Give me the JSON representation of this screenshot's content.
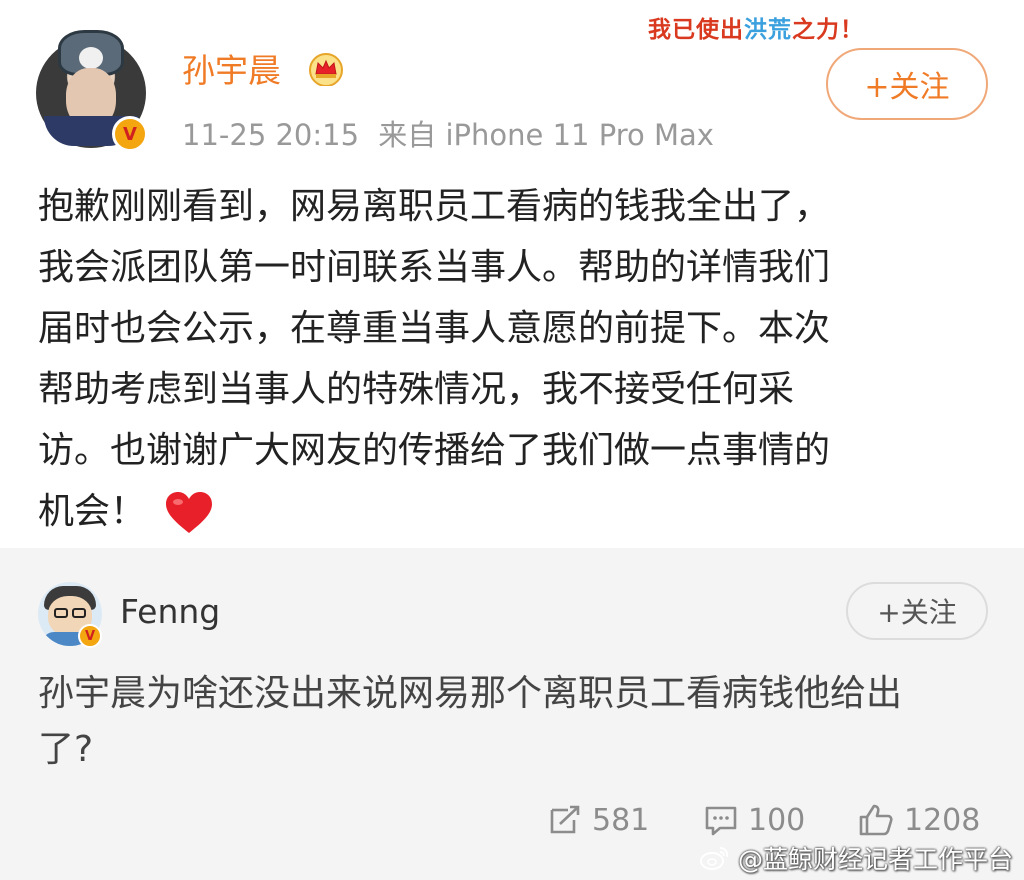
{
  "post": {
    "author": "孙宇晨",
    "time": "11-25 20:15",
    "source": "来自 iPhone 11 Pro Max",
    "follow_label": "+关注",
    "badge_text": "我已使出洪荒之力！",
    "badge_part1": "我已使出",
    "badge_part2": "洪荒",
    "badge_part3": "之力！",
    "verified_letter": "V",
    "lines": [
      "抱歉刚刚看到，网易离职员工看病的钱我全出了，",
      "我会派团队第一时间联系当事人。帮助的详情我们",
      "届时也会公示，在尊重当事人意愿的前提下。本次",
      "帮助考虑到当事人的特殊情况，我不接受任何采",
      "访。也谢谢广大网友的传播给了我们做一点事情的",
      "机会！"
    ],
    "emoji_icon": "heart-icon"
  },
  "repost": {
    "author": "Fenng",
    "follow_label": "+关注",
    "verified_letter": "V",
    "lines": [
      "孙宇晨为啥还没出来说网易那个离职员工看病钱他给出",
      "了?"
    ]
  },
  "actions": {
    "repost_count": "581",
    "comment_count": "100",
    "like_count": "1208"
  },
  "watermark": {
    "text": "@蓝鲸财经记者工作平台"
  },
  "colors": {
    "accent_orange": "#f07b26",
    "verified_gold": "#f3a60f",
    "heart_red": "#e8202a",
    "repost_bg": "#f4f4f4"
  }
}
